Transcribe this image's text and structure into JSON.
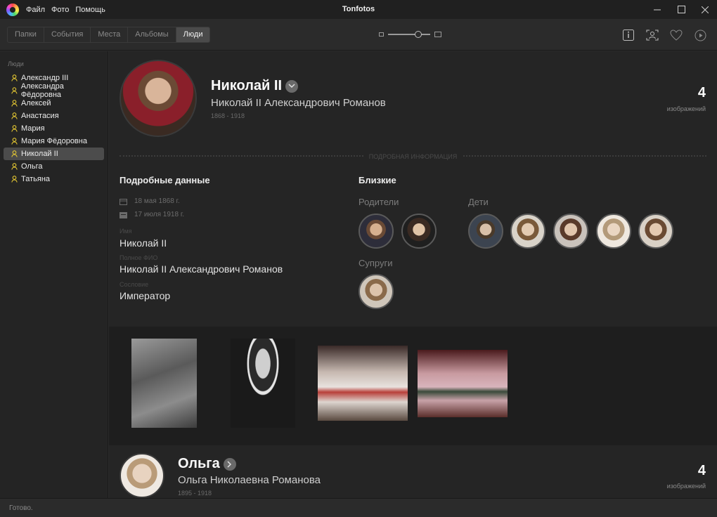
{
  "app": {
    "title": "Tonfotos",
    "menu": [
      "Файл",
      "Фото",
      "Помощь"
    ]
  },
  "toolbar": {
    "tabs": [
      "Папки",
      "События",
      "Места",
      "Альбомы",
      "Люди"
    ],
    "active_tab": "Люди",
    "zoom_level": 0.75
  },
  "sidebar": {
    "header": "Люди",
    "items": [
      "Александр III",
      "Александра Фёдоровна",
      "Алексей",
      "Анастасия",
      "Мария",
      "Мария Фёдоровна",
      "Николай II",
      "Ольга",
      "Татьяна"
    ],
    "selected": "Николай II"
  },
  "person": {
    "name": "Николай II",
    "full_name": "Николай II Александрович Романов",
    "years": "1868 - 1918",
    "count": "4",
    "count_label": "изображений",
    "divider_label": "ПОДРОБНАЯ ИНФОРМАЦИЯ",
    "details_title": "Подробные данные",
    "birth_date": "18 мая 1868 г.",
    "death_date": "17 июля 1918 г.",
    "name_label": "Имя",
    "name_value": "Николай II",
    "fullname_label": "Полное ФИО",
    "fullname_value": "Николай II Александрович Романов",
    "title_label": "Сословие",
    "title_value": "Император",
    "relatives_title": "Близкие",
    "parents_label": "Родители",
    "children_label": "Дети",
    "spouses_label": "Супруги"
  },
  "next_person": {
    "name": "Ольга",
    "full_name": "Ольга Николаевна Романова",
    "years": "1895 - 1918",
    "count": "4",
    "count_label": "изображений"
  },
  "status": {
    "text": "Готово."
  },
  "colors": {
    "accent_person_icon": "#e5c832",
    "background": "#252525",
    "sidebar": "#242424"
  }
}
